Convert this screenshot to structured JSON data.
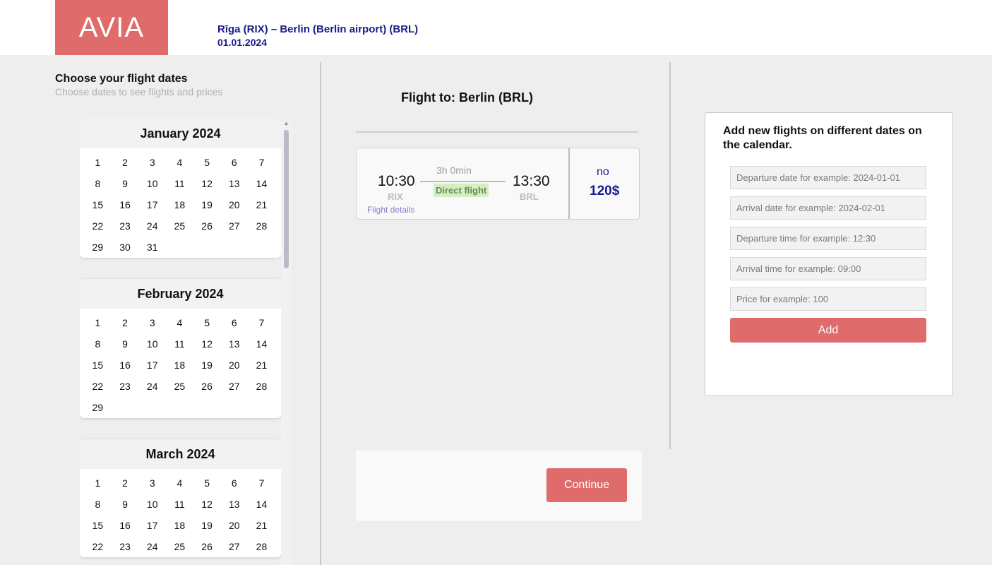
{
  "header": {
    "logo": "AVIA",
    "route": "Rīga (RIX) – Berlin (Berlin airport) (BRL)",
    "date": "01.01.2024"
  },
  "calendar": {
    "title": "Choose your flight dates",
    "subtitle": "Choose dates to see flights and prices",
    "months": [
      {
        "name": "January 2024",
        "days": 31
      },
      {
        "name": "February 2024",
        "days": 29
      },
      {
        "name": "March 2024",
        "days": 28
      }
    ]
  },
  "main": {
    "flight_to": "Flight to: Berlin (BRL)",
    "flight": {
      "departure_time": "10:30",
      "departure_code": "RIX",
      "duration": "3h 0min",
      "direct_label": "Direct flight",
      "arrival_time": "13:30",
      "arrival_code": "BRL",
      "details_link": "Flight details",
      "availability": "no",
      "price": "120$"
    },
    "continue_label": "Continue"
  },
  "add_panel": {
    "title": "Add new flights on different dates on the calendar.",
    "placeholders": {
      "departure_date": "Departure date for example: 2024-01-01",
      "arrival_date": "Arrival date for example: 2024-02-01",
      "departure_time": "Departure time for example: 12:30",
      "arrival_time": "Arrival time for example: 09:00",
      "price": "Price for example: 100"
    },
    "add_label": "Add"
  },
  "colors": {
    "brand": "#e06b6b",
    "accent_text": "#1a1a8c",
    "direct_badge": "#d4efc2"
  }
}
